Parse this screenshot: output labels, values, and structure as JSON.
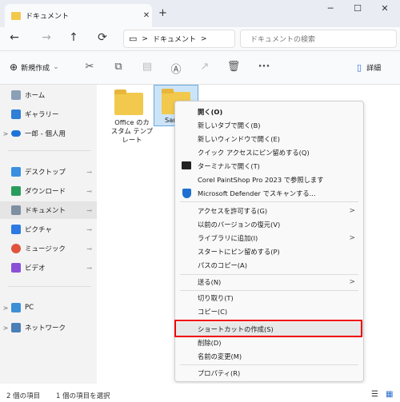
{
  "tab": {
    "title": "ドキュメント",
    "close": "✕",
    "new": "+"
  },
  "window": {
    "min": "─",
    "max": "☐",
    "close": "✕"
  },
  "nav": {
    "back": "←",
    "forward": "→",
    "up": "↑",
    "refresh": "⟳"
  },
  "address": {
    "monitor_icon": "▭",
    "chev1": ">",
    "crumb": "ドキュメント",
    "chev2": ">"
  },
  "search": {
    "placeholder": "ドキュメントの検索",
    "icon": "⌕"
  },
  "toolbar": {
    "new_label": "新規作成",
    "new_chev": "⌄",
    "details_label": "詳細",
    "more": "···"
  },
  "sidebar": {
    "home": "ホーム",
    "gallery": "ギャラリー",
    "onedrive": "一郎 - 個人用",
    "desktop": "デスクトップ",
    "downloads": "ダウンロード",
    "documents": "ドキュメント",
    "pictures": "ピクチャ",
    "music": "ミュージック",
    "videos": "ビデオ",
    "pc": "PC",
    "network": "ネットワーク",
    "pin": "📌",
    "chev": ">"
  },
  "files": {
    "folder1_line1": "Office のカ",
    "folder1_line2": "スタム テンプ",
    "folder1_line3": "レート",
    "folder2": "Sam"
  },
  "menu": {
    "open": "開く(O)",
    "new_tab": "新しいタブで開く(B)",
    "new_window": "新しいウィンドウで開く(E)",
    "pin_quick": "クイック アクセスにピン留めする(Q)",
    "terminal": "ターミナルで開く(T)",
    "corel": "Corel PaintShop Pro 2023 で参照します",
    "defender": "Microsoft Defender でスキャンする...",
    "access": "アクセスを許可する(G)",
    "prev": "以前のバージョンの復元(V)",
    "library": "ライブラリに追加(I)",
    "pin_start": "スタートにピン留めする(P)",
    "copy_path": "パスのコピー(A)",
    "send": "送る(N)",
    "cut": "切り取り(T)",
    "copy": "コピー(C)",
    "shortcut": "ショートカットの作成(S)",
    "delete": "削除(D)",
    "rename": "名前の変更(M)",
    "properties": "プロパティ(R)",
    "sub": ">"
  },
  "status": {
    "count": "2 個の項目",
    "selected": "1 個の項目を選択"
  },
  "colors": {
    "highlight": "#e00000",
    "folder": "#f2c94c"
  }
}
